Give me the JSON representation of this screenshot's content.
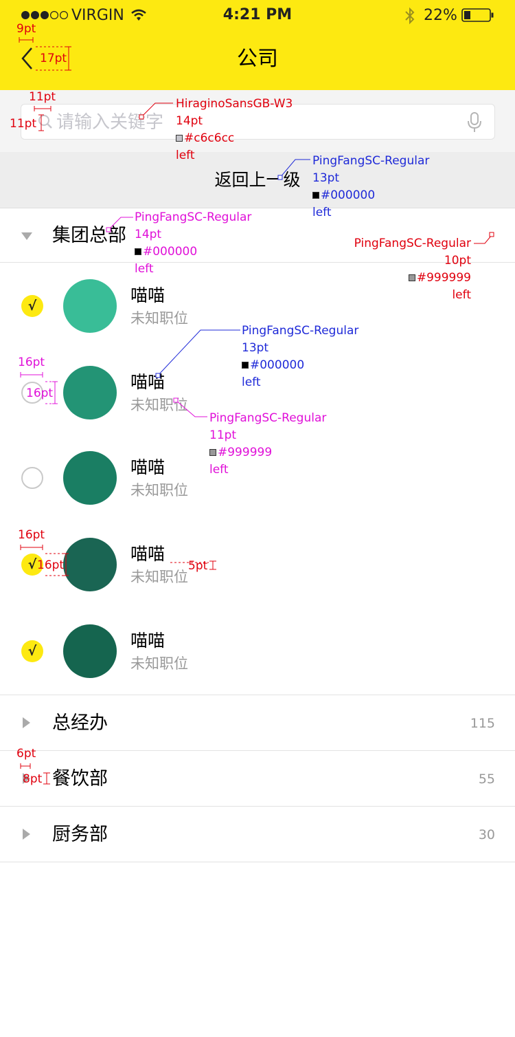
{
  "status_bar": {
    "carrier": "VIRGIN",
    "time": "4:21 PM",
    "battery": "22%",
    "icons": [
      "signal-dots-icon",
      "wifi-icon",
      "bluetooth-icon",
      "battery-icon"
    ]
  },
  "nav": {
    "title": "公司",
    "back_icon": "chevron-left-icon"
  },
  "search": {
    "placeholder": "请输入关键字",
    "icons": [
      "search-icon",
      "microphone-icon"
    ]
  },
  "back_level": {
    "label": "返回上一级"
  },
  "groups": [
    {
      "name": "集团总部",
      "expanded": true,
      "count": ""
    },
    {
      "name": "总经办",
      "expanded": false,
      "count": "115"
    },
    {
      "name": "餐饮部",
      "expanded": false,
      "count": "55"
    },
    {
      "name": "厨务部",
      "expanded": false,
      "count": "30"
    }
  ],
  "members": [
    {
      "name": "喵喵",
      "role": "未知职位",
      "checked": true,
      "avatar_color": "#39bd97"
    },
    {
      "name": "喵喵",
      "role": "未知职位",
      "checked": false,
      "avatar_color": "#239475"
    },
    {
      "name": "喵喵",
      "role": "未知职位",
      "checked": false,
      "avatar_color": "#1a7e63"
    },
    {
      "name": "喵喵",
      "role": "未知职位",
      "checked": true,
      "avatar_color": "#1a6553"
    },
    {
      "name": "喵喵",
      "role": "未知职位",
      "checked": true,
      "avatar_color": "#15654f"
    }
  ],
  "check_mark": "√",
  "colors": {
    "header": "#fde911",
    "check_on": "#fde911",
    "muted_text": "#999999",
    "placeholder": "#c6c6cc",
    "anno_red": "#e0000e",
    "anno_blue": "#1f2ad8",
    "anno_magenta": "#e010d8"
  },
  "annotations": {
    "back_icon_gap": "9pt",
    "back_icon_height": "17pt",
    "search_icon_gap": "11pt",
    "search_icon_height": "11pt",
    "search_spec": {
      "font": "HiraginoSansGB-W3",
      "size": "14pt",
      "color": "#c6c6cc",
      "align": "left"
    },
    "back_level_spec": {
      "font": "PingFangSC-Regular",
      "size": "13pt",
      "color": "#000000",
      "align": "left"
    },
    "group_spec": {
      "font": "PingFangSC-Regular",
      "size": "14pt",
      "color": "#000000",
      "align": "left"
    },
    "count_spec": {
      "font": "PingFangSC-Regular",
      "size": "10pt",
      "color": "#999999",
      "align": "left"
    },
    "name_spec": {
      "font": "PingFangSC-Regular",
      "size": "13pt",
      "color": "#000000",
      "align": "left"
    },
    "role_spec": {
      "font": "PingFangSC-Regular",
      "size": "11pt",
      "color": "#999999",
      "align": "left"
    },
    "check_gap_1": "16pt",
    "check_size_1": "16pt",
    "check_gap_2": "16pt",
    "check_size_2": "16pt",
    "line_gap": "5pt",
    "arrow_gap": "6pt",
    "arrow_size": "8pt"
  }
}
